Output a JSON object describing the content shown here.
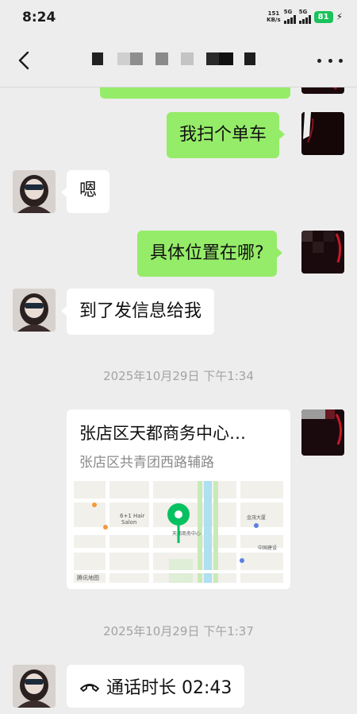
{
  "status_bar": {
    "time": "8:24",
    "net_speed_value": "151",
    "net_speed_unit": "KB/s",
    "signal1_label": "5G",
    "signal2_label": "5G",
    "battery": "81",
    "icons": [
      "signal-icon",
      "battery-icon",
      "charging-icon"
    ]
  },
  "nav": {
    "back_icon": "chevron-left-icon",
    "more_icon": "more-dots-icon"
  },
  "messages": {
    "m1": "我扫个单车",
    "m2": "嗯",
    "m3": "具体位置在哪?",
    "m4": "到了发信息给我",
    "time1": "2025年10月29日 下午1:34",
    "location": {
      "title": "张店区天都商务中心…",
      "address": "张店区共青团西路辅路",
      "map_labels": {
        "a": "6+1 Hair",
        "b": "Salon",
        "c": "天都商务中心",
        "d": "金茂大厦",
        "e": "中国建设",
        "f": "腾讯地图"
      }
    },
    "time2": "2025年10月29日 下午1:37",
    "call": {
      "label": "通话时长 02:43",
      "icon": "phone-icon"
    }
  },
  "colors": {
    "background": "#ededed",
    "sent_bubble": "#95ec69",
    "received_bubble": "#ffffff",
    "timestamp_text": "#a3a3a3",
    "map_pin": "#07c160",
    "battery_fill": "#19c35a"
  }
}
